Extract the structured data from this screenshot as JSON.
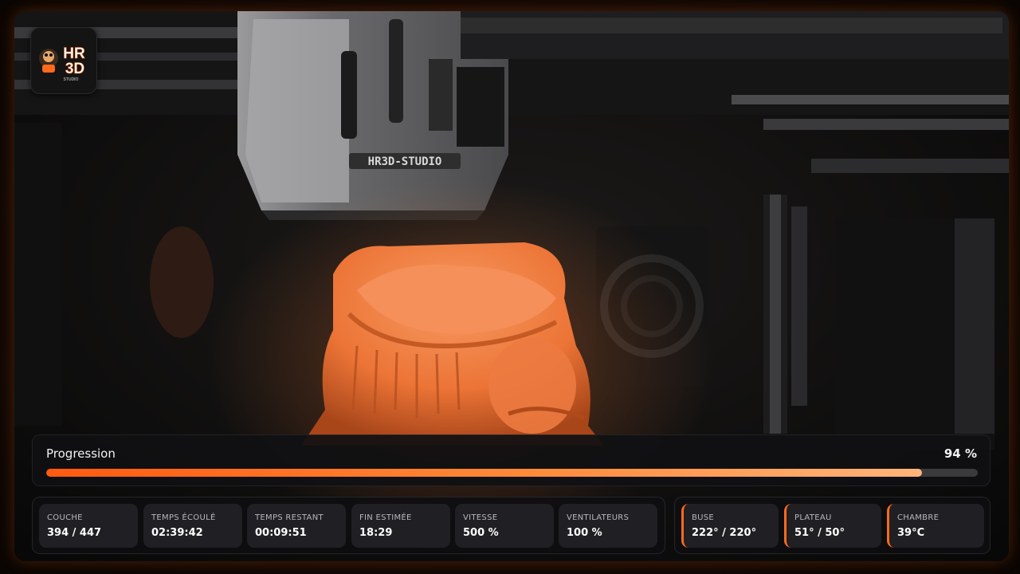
{
  "camera": {
    "nameplate": "HR3D-STUDIO"
  },
  "logo": {
    "line1": "HR",
    "line2": "3D",
    "line3": "STUDIO",
    "accent_color": "#ff6a1c"
  },
  "progress": {
    "label": "Progression",
    "percent_text": "94 %",
    "value": 0.94
  },
  "stats": [
    {
      "title": "COUCHE",
      "value": "394 / 447"
    },
    {
      "title": "TEMPS ÉCOULÉ",
      "value": "02:39:42"
    },
    {
      "title": "TEMPS RESTANT",
      "value": "00:09:51"
    },
    {
      "title": "FIN ESTIMÉE",
      "value": "18:29"
    },
    {
      "title": "VITESSE",
      "value": "500 %"
    },
    {
      "title": "VENTILATEURS",
      "value": "100 %"
    }
  ],
  "temps": [
    {
      "title": "BUSE",
      "value": "222° / 220°"
    },
    {
      "title": "PLATEAU",
      "value": "51° / 50°"
    },
    {
      "title": "CHAMBRE",
      "value": "39°C"
    }
  ],
  "colors": {
    "accent": "#ff6a1c",
    "print_orange": "#f07a3c"
  }
}
